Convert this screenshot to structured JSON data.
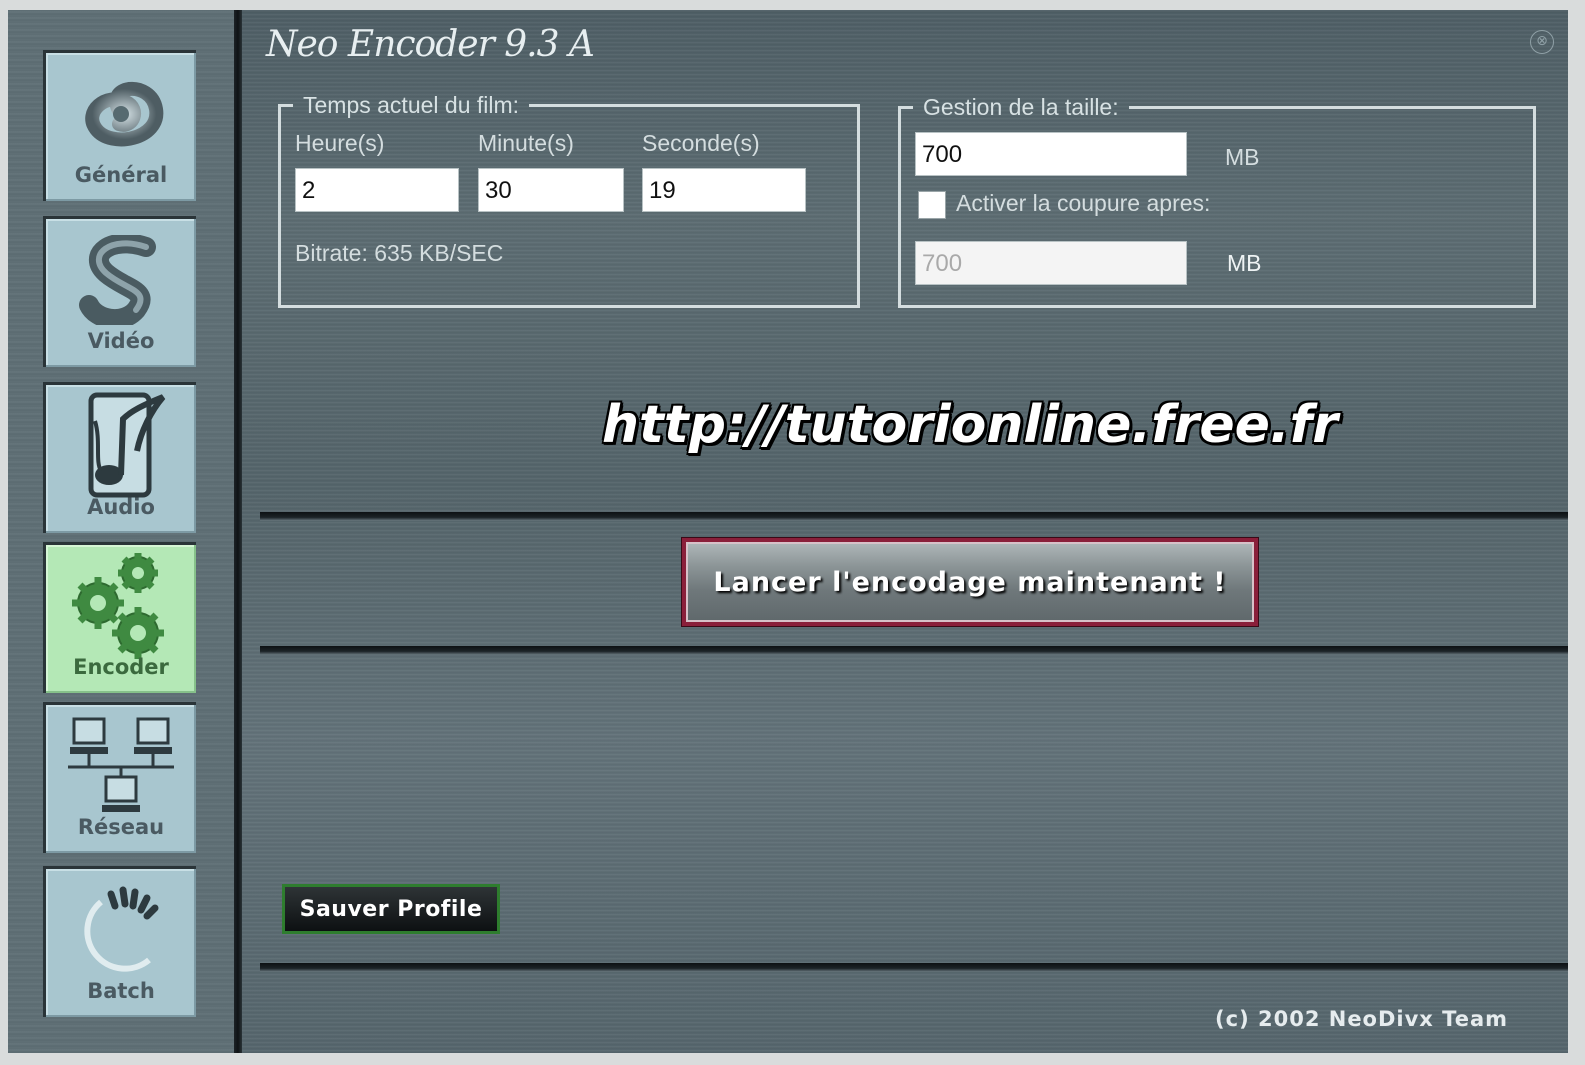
{
  "window": {
    "title": "Neo Encoder 9.3 A",
    "close_symbol": "⊗"
  },
  "sidebar": {
    "items": [
      {
        "label": "Général",
        "icon": "swirl-icon"
      },
      {
        "label": "Vidéo",
        "icon": "video-s-icon"
      },
      {
        "label": "Audio",
        "icon": "music-note-icon"
      },
      {
        "label": "Encoder",
        "icon": "gears-icon",
        "active": true
      },
      {
        "label": "Réseau",
        "icon": "network-icon"
      },
      {
        "label": "Batch",
        "icon": "batch-spinner-icon"
      }
    ]
  },
  "time_group": {
    "legend": "Temps actuel du film:",
    "hours_label": "Heure(s)",
    "minutes_label": "Minute(s)",
    "seconds_label": "Seconde(s)",
    "hours_value": "2",
    "minutes_value": "30",
    "seconds_value": "19",
    "bitrate_text": "Bitrate: 635 KB/SEC"
  },
  "size_group": {
    "legend": "Gestion de la taille:",
    "size_value": "700",
    "size_unit": "MB",
    "split_label": "Activer la coupure apres:",
    "split_checked": false,
    "split_value": "700",
    "split_unit": "MB"
  },
  "banner_url": "http://tutorionline.free.fr",
  "encode_button": "Lancer l'encodage maintenant !",
  "save_button": "Sauver Profile",
  "copyright": "(c) 2002 NeoDivx Team",
  "colors": {
    "active_tab": "#b4e8b6",
    "inactive_tab": "#a8c6cf",
    "encode_border": "#8a1f3a",
    "save_border": "#2e7d2e"
  }
}
